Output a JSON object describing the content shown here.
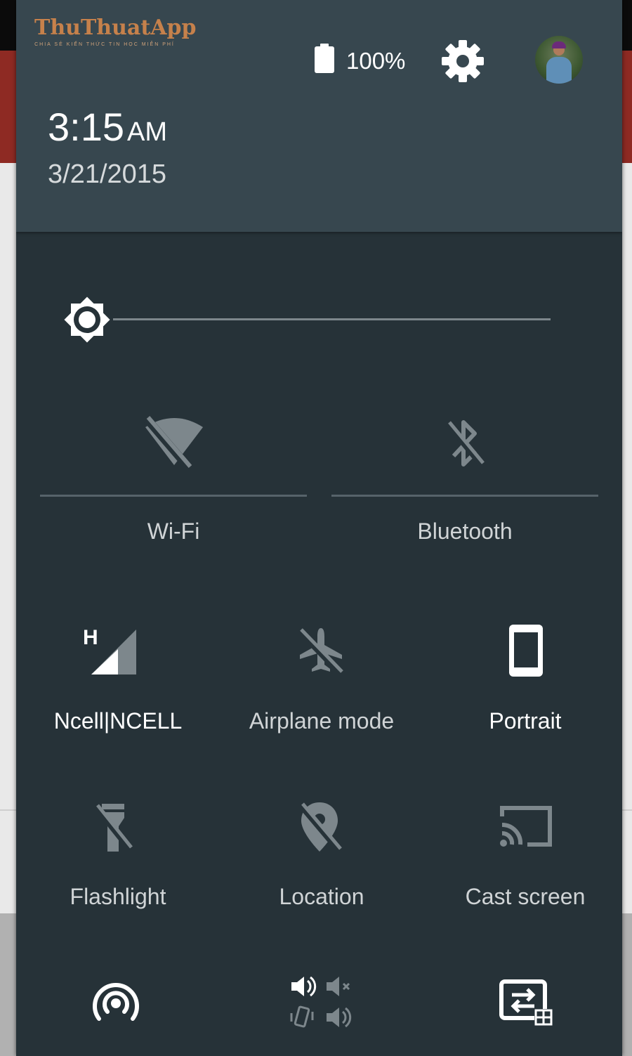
{
  "logo": {
    "title": "ThuThuatApp",
    "subtitle": "CHIA SẺ KIẾN THỨC TIN HỌC MIỄN PHÍ"
  },
  "status": {
    "battery_percent": "100%",
    "battery_level": 1.0
  },
  "header": {
    "time": "3:15",
    "ampm": "AM",
    "date": "3/21/2015"
  },
  "brightness": {
    "level": 0.0
  },
  "tiles_large": [
    {
      "label": "Wi-Fi",
      "icon": "wifi-off-icon",
      "active": false
    },
    {
      "label": "Bluetooth",
      "icon": "bluetooth-disabled-icon",
      "active": false
    }
  ],
  "tiles_row1": [
    {
      "label": "Ncell|NCELL",
      "icon": "cellular-signal-icon",
      "network_type": "H",
      "active": true
    },
    {
      "label": "Airplane mode",
      "icon": "airplane-off-icon",
      "active": false
    },
    {
      "label": "Portrait",
      "icon": "portrait-phone-icon",
      "active": true
    }
  ],
  "tiles_row2": [
    {
      "label": "Flashlight",
      "icon": "flashlight-off-icon",
      "active": false
    },
    {
      "label": "Location",
      "icon": "location-off-icon",
      "active": false
    },
    {
      "label": "Cast screen",
      "icon": "cast-icon",
      "active": false
    }
  ],
  "tiles_row3": [
    {
      "icon": "hotspot-icon"
    },
    {
      "icon": "sound-modes-icon"
    },
    {
      "icon": "screen-switch-icon"
    }
  ],
  "colors": {
    "panel": "#263238",
    "header": "#37474f",
    "icon_inactive": "#7d878c",
    "icon_active": "#ffffff",
    "logo": "#c6814b"
  }
}
